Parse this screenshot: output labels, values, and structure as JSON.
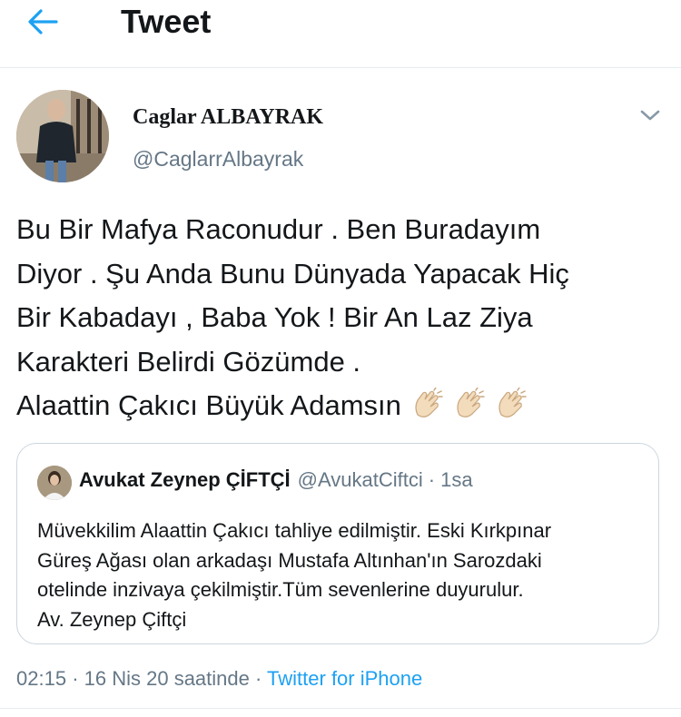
{
  "header": {
    "back_icon": "arrow-left-icon",
    "title": "Tweet"
  },
  "colors": {
    "accent": "#1da1f2",
    "text": "#14171a",
    "secondary": "#657786",
    "border": "#ccd6dd"
  },
  "tweet": {
    "display_name": "Caglar ALBAYRAK",
    "handle": "@CaglarrAlbayrak",
    "menu_icon": "chevron-down-icon",
    "text_lines": [
      "Bu Bir Mafya Raconudur . Ben Buradayım",
      "Diyor . Şu Anda Bunu Dünyada Yapacak Hiç",
      "Bir Kabadayı , Baba Yok ! Bir An Laz Ziya",
      "Karakteri Belirdi Gözümde .",
      "Alaattin Çakıcı Büyük Adamsın"
    ],
    "emoji_icon": "clapping-hands-icon",
    "emoji_count": 3,
    "time": "02:15",
    "date": "16 Nis 20 saatinde",
    "source": "Twitter for iPhone"
  },
  "quoted": {
    "display_name": "Avukat Zeynep ÇİFTÇİ",
    "handle": "@AvukatCiftci",
    "separator": "·",
    "time": "1sa",
    "text_lines": [
      "Müvekkilim Alaattin Çakıcı tahliye edilmiştir. Eski Kırkpınar",
      "Güreş Ağası olan arkadaşı Mustafa Altınhan'ın Sarozdaki",
      "otelinde inzivaya çekilmiştir.Tüm sevenlerine duyurulur.",
      "Av. Zeynep Çiftçi"
    ]
  },
  "meta_separator": "·"
}
